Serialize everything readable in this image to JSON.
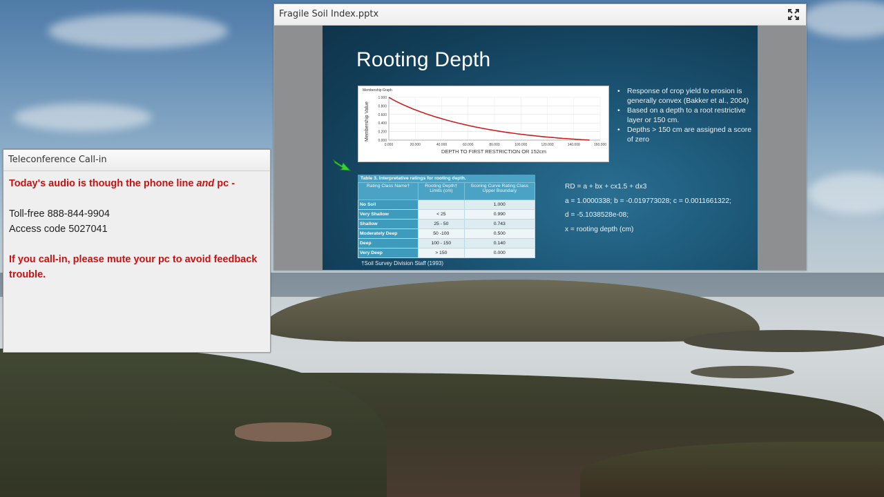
{
  "share_pod": {
    "title": "Fragile Soil Index.pptx",
    "maximize_icon": "expand-icon",
    "slide": {
      "title": "Rooting Depth",
      "bullets": [
        "Response of crop yield to erosion is generally convex (Bakker et al., 2004)",
        "Based on a depth to a root restrictive layer or 150 cm.",
        "Depths > 150 cm are assigned a score of zero"
      ],
      "graph": {
        "title": "Membership Graph",
        "ylabel": "Membership Value",
        "xlabel": "DEPTH TO FIRST RESTRICTION OR 152cm",
        "y_ticks": [
          "1.000",
          "0.800",
          "0.600",
          "0.400",
          "0.200",
          "0.000"
        ],
        "x_ticks": [
          "0.000",
          "20.000",
          "40.000",
          "60.000",
          "80.000",
          "100.000",
          "120.000",
          "140.000",
          "160.000"
        ],
        "line_color": "#c81e1e"
      },
      "table": {
        "caption": "Table 3. Interpretative ratings for rooting depth.",
        "headers": [
          "Rating Class Name†",
          "Rooting Depth† Limits (cm)",
          "Scoring Curve Rating Class Upper Boundary"
        ],
        "rows": [
          [
            "No Soil",
            "",
            "1.000"
          ],
          [
            "Very Shallow",
            "< 25",
            "0.990"
          ],
          [
            "Shallow",
            "25 - 50",
            "0.743"
          ],
          [
            "Moderately Deep",
            "50 -100",
            "0.500"
          ],
          [
            "Deep",
            "100 - 150",
            "0.140"
          ],
          [
            "Very Deep",
            "> 150",
            "0.000"
          ]
        ],
        "footnote": "†Soil Survey Division Staff (1993)"
      },
      "equations": [
        "RD = a + bx + cx1.5 + dx3",
        "a = 1.0000338; b = -0.019773028; c = 0.0011661322;",
        "d = -5.1038528e-08;",
        "x = rooting depth (cm)"
      ],
      "pointer_icon": "green-arrow-icon"
    }
  },
  "callin_pod": {
    "title": "Teleconference Call-in",
    "audio_prefix": "Today's audio is though the phone line ",
    "audio_and": "and",
    "audio_suffix": " pc -",
    "tollfree": "Toll-free 888-844-9904",
    "access": "Access code 5027041",
    "mute_notice": "If you call-in, please mute your pc to avoid feedback trouble."
  }
}
